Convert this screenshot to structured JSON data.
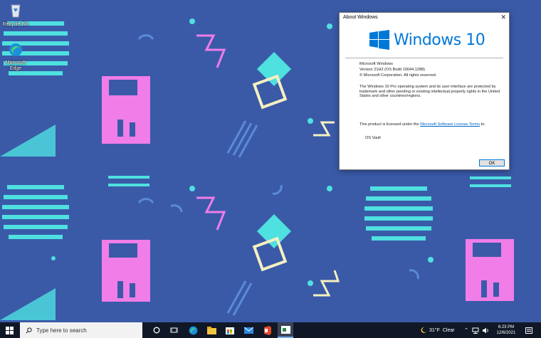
{
  "desktop": {
    "icons": [
      {
        "label": "Recycle Bin",
        "icon": "recycle-bin-icon"
      },
      {
        "label": "Microsoft Edge",
        "icon": "edge-icon"
      }
    ]
  },
  "dialog": {
    "title": "About Windows",
    "logo_text": "Windows 10",
    "product_name": "Microsoft Windows",
    "version": "Version 21H2 (OS Build 19044.1288)",
    "copyright": "© Microsoft Corporation. All rights reserved.",
    "description": "The Windows 10 Pro operating system and its user interface are protected by trademark and other pending or existing intellectual property rights in the United States and other countries/regions.",
    "license_prefix": "This product is licensed under the",
    "license_link": "Microsoft Software License Terms",
    "license_suffix": "to:",
    "licensee": "OS Vault",
    "ok_label": "OK",
    "close_glyph": "✕"
  },
  "taskbar": {
    "search_placeholder": "Type here to search",
    "weather_temp": "31°F",
    "weather_text": "Clear",
    "time": "6:23 PM",
    "date": "12/6/2021",
    "accent_color": "#0078d7"
  }
}
